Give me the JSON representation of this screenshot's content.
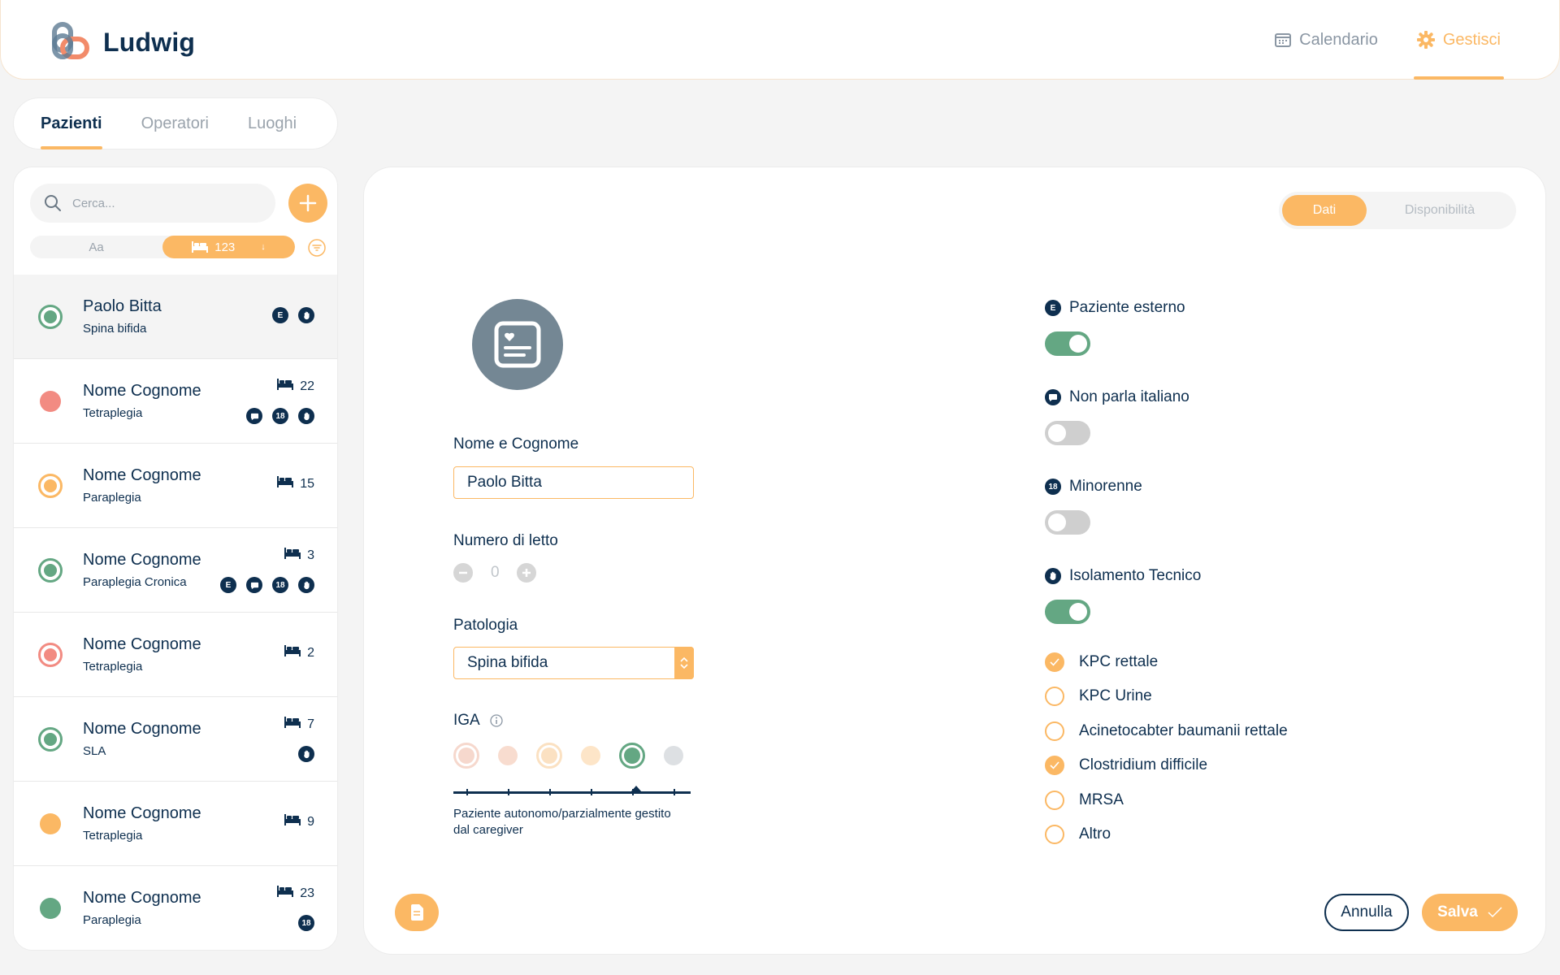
{
  "app": {
    "name": "Ludwig"
  },
  "nav": {
    "calendar_label": "Calendario",
    "manage_label": "Gestisci"
  },
  "tabs": [
    {
      "label": "Pazienti",
      "active": true
    },
    {
      "label": "Operatori",
      "active": false
    },
    {
      "label": "Luoghi",
      "active": false
    }
  ],
  "sidebar": {
    "search_placeholder": "Cerca...",
    "sort_alpha_label": "Aa",
    "sort_bed_label": "123",
    "sort_direction": "↓",
    "patients": [
      {
        "name": "Paolo Bitta",
        "pathology": "Spina bifida",
        "status": "ring",
        "status_color": "#64a783",
        "bed": "",
        "badges": [
          "E",
          "hand"
        ],
        "selected": true
      },
      {
        "name": "Nome Cognome",
        "pathology": "Tetraplegia",
        "status": "dot",
        "status_color": "#f28b82",
        "bed": "22",
        "badges": [
          "chat",
          "18",
          "hand"
        ],
        "selected": false
      },
      {
        "name": "Nome Cognome",
        "pathology": "Paraplegia",
        "status": "ring",
        "status_color": "#fbb864",
        "bed": "15",
        "badges": [],
        "selected": false
      },
      {
        "name": "Nome Cognome",
        "pathology": "Paraplegia Cronica",
        "status": "ring",
        "status_color": "#64a783",
        "bed": "3",
        "badges": [
          "E",
          "chat",
          "18",
          "hand"
        ],
        "selected": false
      },
      {
        "name": "Nome Cognome",
        "pathology": "Tetraplegia",
        "status": "ring",
        "status_color": "#f28b82",
        "bed": "2",
        "badges": [],
        "selected": false
      },
      {
        "name": "Nome Cognome",
        "pathology": "SLA",
        "status": "ring",
        "status_color": "#64a783",
        "bed": "7",
        "badges": [
          "hand"
        ],
        "selected": false
      },
      {
        "name": "Nome Cognome",
        "pathology": "Tetraplegia",
        "status": "dot",
        "status_color": "#fbb864",
        "bed": "9",
        "badges": [],
        "selected": false
      },
      {
        "name": "Nome Cognome",
        "pathology": "Paraplegia",
        "status": "dot",
        "status_color": "#64a783",
        "bed": "23",
        "badges": [
          "18"
        ],
        "selected": false
      }
    ]
  },
  "main": {
    "segments": {
      "data_label": "Dati",
      "availability_label": "Disponibilità"
    },
    "name_label": "Nome e Cognome",
    "name_value": "Paolo Bitta",
    "bed_label": "Numero di letto",
    "bed_value": "0",
    "pathology_label": "Patologia",
    "pathology_value": "Spina bifida",
    "iga_label": "IGA",
    "iga_levels": [
      {
        "type": "ring",
        "color": "#f6d8cd",
        "selected": false
      },
      {
        "type": "dot",
        "color": "#f8dccf",
        "selected": false
      },
      {
        "type": "ring",
        "color": "#fbe1c2",
        "selected": false
      },
      {
        "type": "dot",
        "color": "#fde5c8",
        "selected": false
      },
      {
        "type": "ring",
        "color": "#64a783",
        "selected": true
      },
      {
        "type": "dot",
        "color": "#dde0e3",
        "selected": false
      }
    ],
    "iga_description": "Paziente autonomo/parzialmente gestito dal caregiver",
    "flags": {
      "external": {
        "label": "Paziente esterno",
        "badge": "E",
        "on": true
      },
      "no_italian": {
        "label": "Non parla italiano",
        "on": false
      },
      "minor": {
        "label": "Minorenne",
        "badge": "18",
        "on": false
      },
      "isolation": {
        "label": "Isolamento Tecnico",
        "on": true
      }
    },
    "infections": [
      {
        "label": "KPC rettale",
        "checked": true
      },
      {
        "label": "KPC Urine",
        "checked": false
      },
      {
        "label": "Acinetocabter baumanii rettale",
        "checked": false
      },
      {
        "label": "Clostridium difficile",
        "checked": true
      },
      {
        "label": "MRSA",
        "checked": false
      },
      {
        "label": "Altro",
        "checked": false
      }
    ],
    "cancel_label": "Annulla",
    "save_label": "Salva"
  },
  "colors": {
    "accent": "#fbb864",
    "navy": "#0e2f4f",
    "green": "#64a783",
    "red": "#f28b82"
  }
}
